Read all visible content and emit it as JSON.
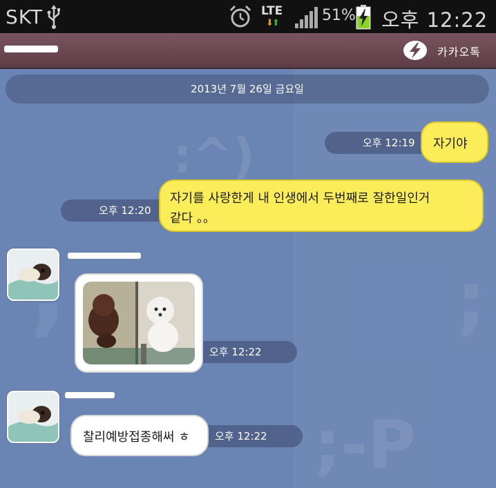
{
  "status_bar": {
    "carrier": "SKT",
    "network": "LTE",
    "battery_percent": "51%",
    "time": "오후 12:22",
    "icons": [
      "usb-icon",
      "alarm-icon",
      "lte-arrows-icon",
      "signal-icon",
      "battery-charging-icon"
    ]
  },
  "title_bar": {
    "app_name": "카카오톡",
    "logo_icon": "kakao-bolt-logo"
  },
  "chat": {
    "date_divider": "2013년 7월 26일 금요일",
    "messages": [
      {
        "side": "sent",
        "type": "text",
        "text": "자기야",
        "time": "오후 12:19"
      },
      {
        "side": "sent",
        "type": "text",
        "lines": [
          "자기를 사랑한게 내 인생에서 두번째로 잘한일인거",
          "같다 。。"
        ],
        "time": "오후 12:20"
      },
      {
        "side": "received",
        "type": "photo",
        "photo_icon": "puppies-photo",
        "time": "오후 12:22"
      },
      {
        "side": "received",
        "type": "text",
        "text": "찰리예방접종해써 ㅎ",
        "time": "오후 12:22"
      }
    ]
  },
  "colors": {
    "chat_background": "#6a84b4",
    "title_bar": "#6b4752",
    "sent_bubble": "#fbec5a",
    "received_bubble": "#ffffff"
  }
}
